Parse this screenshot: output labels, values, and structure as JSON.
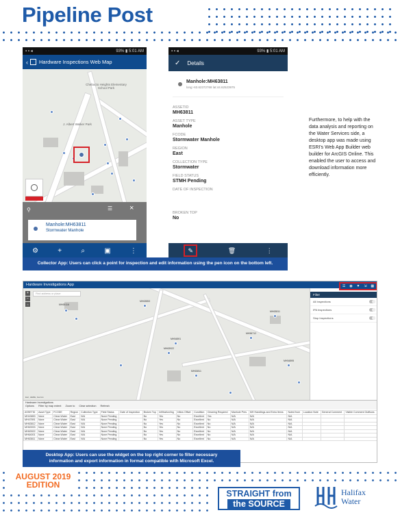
{
  "page": {
    "title": "Pipeline Post",
    "edition_line1": "AUGUST 2019",
    "edition_line2": "EDITION",
    "straight_line1": "STRAIGHT from",
    "straight_line2": "the SOURCE",
    "logo_line1": "Halifax",
    "logo_line2": "Water",
    "side_text": "Furthermore, to help with the data analysis and reporting on the Water Services side, a desktop app was made using ESRI's Web App Builder web builder for ArcGIS Online. This enabled the user to access and download information more efficiently.",
    "caption1": "Collector App: Users can click a point for inspection and edit information using the pen icon on the bottom left.",
    "caption2_line1": "Desktop App: Users can use the widget on the top right corner to filter necessary",
    "caption2_line2": "information and export information in format compatible with Microsoft Excel."
  },
  "phone1": {
    "status_time": "93% ▮ 5:01 AM",
    "app_title": "Hardware Inspections Web Map",
    "map_label1": "Chebucto Heights Elementary School Park",
    "map_label2": "J. Albert Walker Park",
    "popup_title": "Manhole:MH63811",
    "popup_subtitle": "Stormwater Manhole"
  },
  "phone2": {
    "status_time": "93% ▮ 5:01 AM",
    "header": "Details",
    "item_title": "Manhole:MH63811",
    "item_coords": "long:-63.62372768 lat:44.62523975",
    "fields": [
      {
        "label": "ASSETID",
        "value": "MH63811"
      },
      {
        "label": "ASSET TYPE",
        "value": "Manhole"
      },
      {
        "label": "FCODE",
        "value": "Stormwater Manhole"
      },
      {
        "label": "REGION",
        "value": "East"
      },
      {
        "label": "COLLECTION TYPE",
        "value": "Stormwater"
      },
      {
        "label": "FIELD STATUS",
        "value": "STMH Pending"
      },
      {
        "label": "DATE OF INSPECTION",
        "value": ""
      },
      {
        "label": "BROKEN TOP",
        "value": "No"
      }
    ]
  },
  "desktop": {
    "app_title": "Hardware Investigations App",
    "search_placeholder": "Find address or place",
    "filter_title": "Filter",
    "filters": [
      "All Inspections",
      "IPA Inspections",
      "Stop Inspections"
    ],
    "table_title": "Hardware Investigations",
    "table_tools": [
      "Options",
      "Filter by map extent",
      "Zoom to",
      "Clear selection",
      "Refresh"
    ],
    "columns": [
      "ASSETID",
      "Asset Type",
      "FCODE",
      "Region",
      "Collection Type",
      "Field Status",
      "Date of Inspection",
      "Broken Top",
      "Infiltration/Ing",
      "Inflow Offset",
      "Condition",
      "Cleaning Required",
      "Manhole Pres",
      "MH Handlings and Extra Items",
      "Noted from",
      "Location Note",
      "General Comment",
      "Visible Comment Outflows"
    ],
    "rows": [
      [
        "MH43853",
        "None",
        "Clean Water",
        "East",
        "N/A",
        "None Pending",
        "",
        "No",
        "Yes",
        "No",
        "Excellent",
        "Yes",
        "N/A",
        "N/A",
        "N/A",
        "",
        "",
        ""
      ],
      [
        "MH47891",
        "None",
        "Clean Water",
        "East",
        "N/A",
        "None Pending",
        "",
        "No",
        "Yes",
        "No",
        "Excellent",
        "No",
        "N/A",
        "N/A",
        "N/A",
        "",
        "",
        ""
      ],
      [
        "MH63812",
        "None",
        "Clean Water",
        "East",
        "N/A",
        "None Pending",
        "",
        "No",
        "Yes",
        "No",
        "Excellent",
        "No",
        "N/A",
        "N/A",
        "N/A",
        "",
        "",
        ""
      ],
      [
        "MH63933",
        "None",
        "Clean Water",
        "East",
        "N/A",
        "None Pending",
        "",
        "No",
        "Yes",
        "No",
        "Excellent",
        "No",
        "N/A",
        "N/A",
        "N/A",
        "",
        "",
        ""
      ],
      [
        "MH63922",
        "None",
        "Clean Water",
        "East",
        "N/A",
        "None Pending",
        "",
        "No",
        "Yes",
        "No",
        "Excellent",
        "No",
        "N/A",
        "N/A",
        "N/A",
        "",
        "",
        ""
      ],
      [
        "MH64001",
        "None",
        "Clean Water",
        "East",
        "N/A",
        "None Pending",
        "",
        "No",
        "Yes",
        "No",
        "Excellent",
        "No",
        "N/A",
        "N/A",
        "N/A",
        "",
        "",
        ""
      ],
      [
        "MH63811",
        "None",
        "Clean Water",
        "East",
        "N/A",
        "None Pending",
        "",
        "No",
        "Yes",
        "No",
        "Excellent",
        "No",
        "N/A",
        "N/A",
        "N/A",
        "",
        "",
        ""
      ]
    ],
    "map_labels": [
      "MH65116",
      "MH63853",
      "MH54891",
      "MH63922",
      "MH63811",
      "MH56712",
      "MH63811",
      "MH54895"
    ],
    "scale": "Esri, HERE, Garmin"
  }
}
